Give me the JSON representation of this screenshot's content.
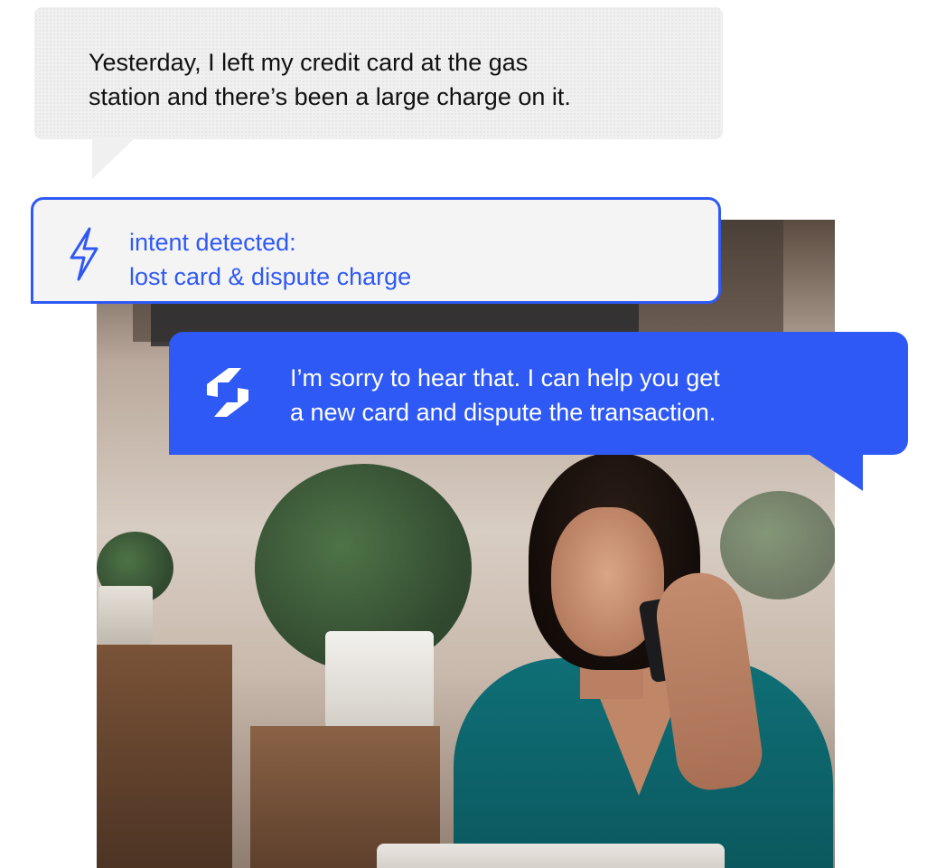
{
  "user_message": {
    "line1": "Yesterday, I left my credit card at the gas",
    "line2": "station and there’s been a large charge on it."
  },
  "intent": {
    "icon": "lightning-bolt-icon",
    "label": "intent detected:",
    "value": "lost card & dispute charge"
  },
  "assistant_message": {
    "icon": "assistant-logo-icon",
    "line1": "I’m sorry to hear that. I can help you get",
    "line2": "a new card and dispute the transaction."
  },
  "colors": {
    "accent": "#2f59f5",
    "user_bubble": "#f0f0f0",
    "intent_bg": "#f4f4f4",
    "text_dark": "#111111",
    "text_light": "#ffffff"
  },
  "photo": {
    "subject": "woman on phone call at laptop"
  }
}
